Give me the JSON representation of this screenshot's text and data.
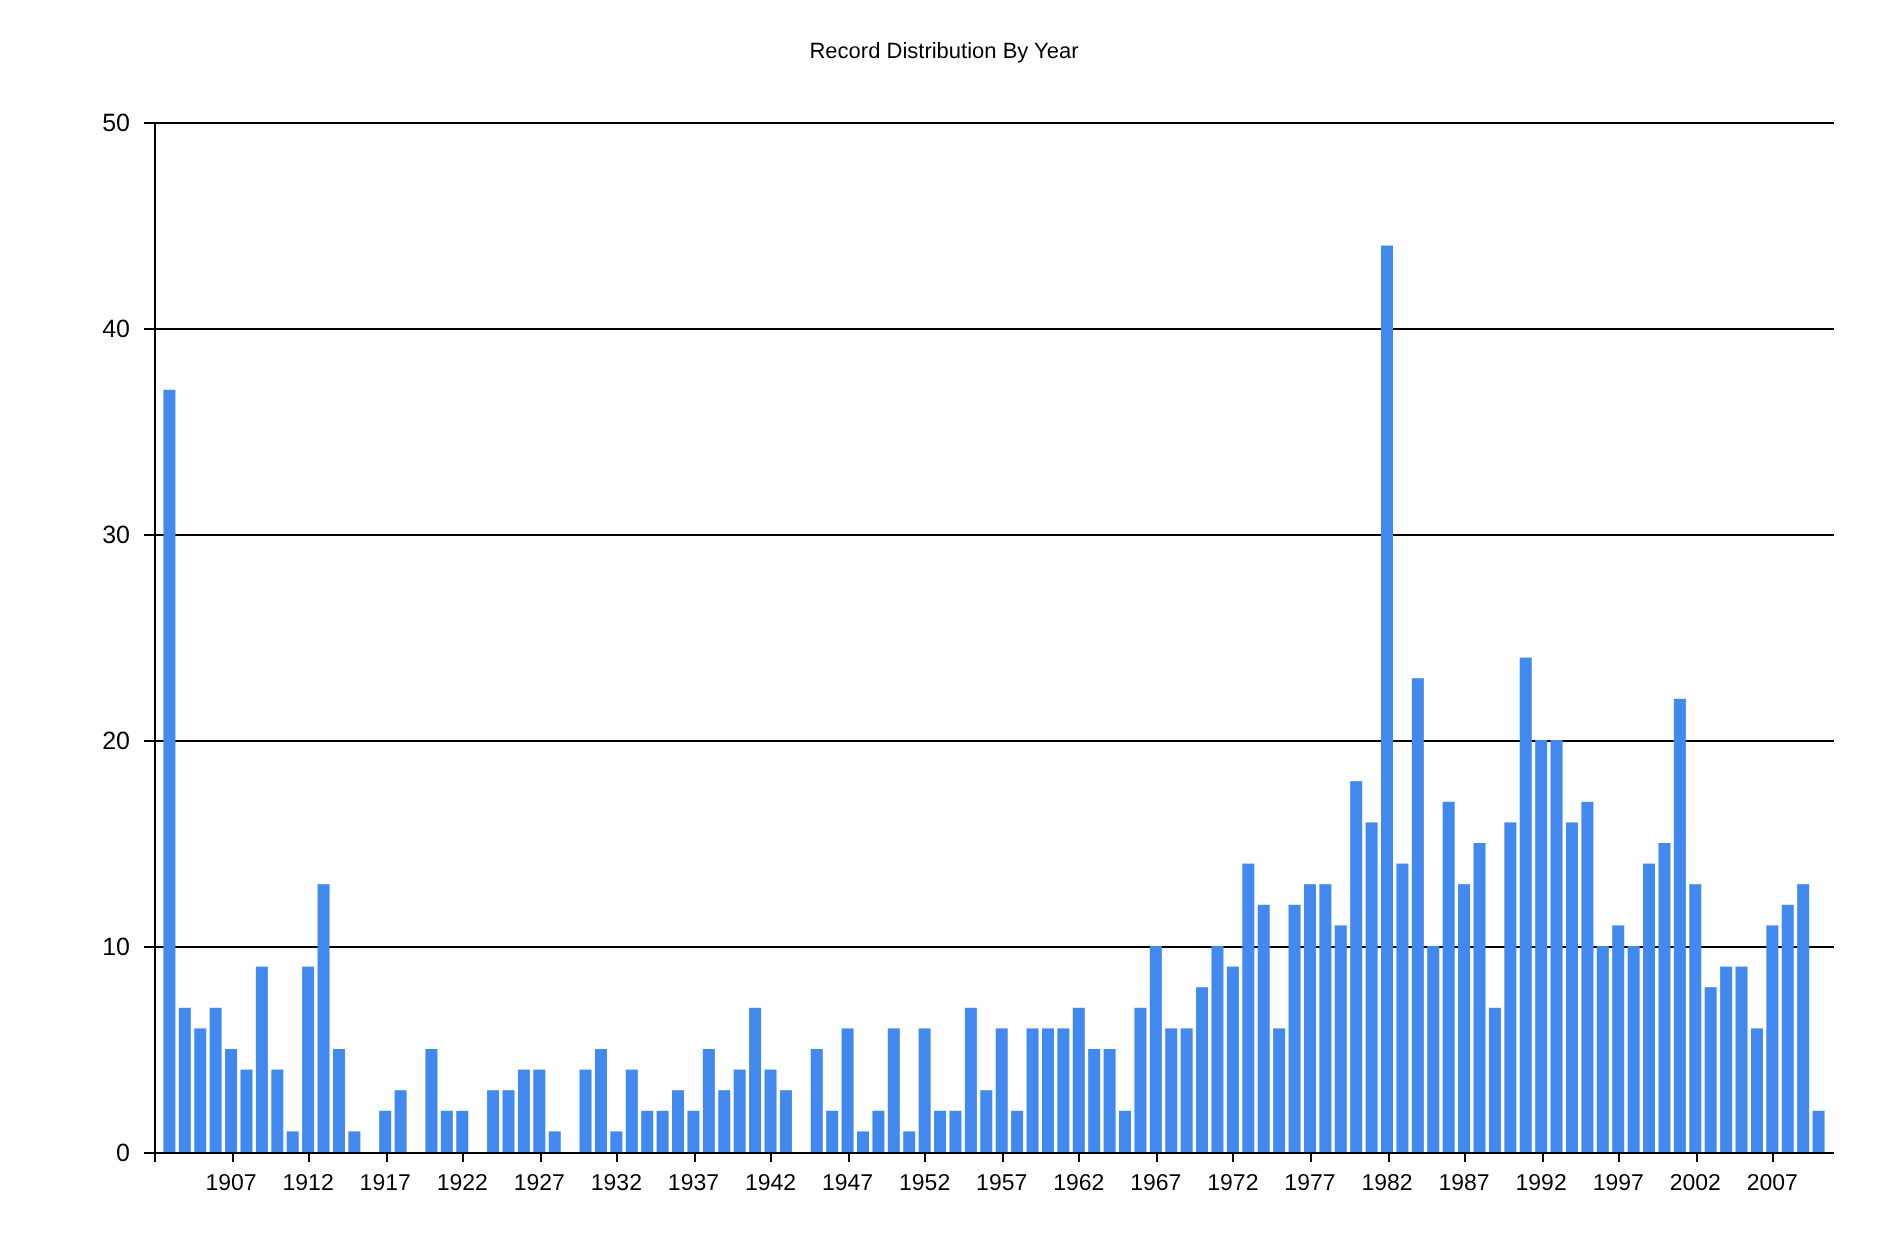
{
  "chart_data": {
    "type": "bar",
    "title": "Record Distribution By Year",
    "x": [
      1903,
      1904,
      1905,
      1906,
      1907,
      1908,
      1909,
      1910,
      1911,
      1912,
      1913,
      1914,
      1915,
      1916,
      1917,
      1918,
      1919,
      1920,
      1921,
      1922,
      1923,
      1924,
      1925,
      1926,
      1927,
      1928,
      1929,
      1930,
      1931,
      1932,
      1933,
      1934,
      1935,
      1936,
      1937,
      1938,
      1939,
      1940,
      1941,
      1942,
      1943,
      1944,
      1945,
      1946,
      1947,
      1948,
      1949,
      1950,
      1951,
      1952,
      1953,
      1954,
      1955,
      1956,
      1957,
      1958,
      1959,
      1960,
      1961,
      1962,
      1963,
      1964,
      1965,
      1966,
      1967,
      1968,
      1969,
      1970,
      1971,
      1972,
      1973,
      1974,
      1975,
      1976,
      1977,
      1978,
      1979,
      1980,
      1981,
      1982,
      1983,
      1984,
      1985,
      1986,
      1987,
      1988,
      1989,
      1990,
      1991,
      1992,
      1993,
      1994,
      1995,
      1996,
      1997,
      1998,
      1999,
      2000,
      2001,
      2002,
      2003,
      2004,
      2005,
      2006,
      2007,
      2008,
      2009,
      2010
    ],
    "series": [
      {
        "color": "#4189ee",
        "values": [
          37,
          7,
          6,
          7,
          5,
          4,
          9,
          4,
          1,
          9,
          13,
          5,
          1,
          0,
          2,
          3,
          0,
          5,
          2,
          2,
          0,
          3,
          3,
          4,
          4,
          1,
          0,
          4,
          5,
          1,
          4,
          2,
          2,
          3,
          2,
          5,
          3,
          4,
          7,
          4,
          3,
          0,
          5,
          2,
          6,
          1,
          2,
          6,
          1,
          6,
          2,
          2,
          7,
          3,
          6,
          2,
          6,
          6,
          6,
          7,
          5,
          5,
          2,
          7,
          10,
          6,
          6,
          8,
          10,
          9,
          14,
          12,
          6,
          12,
          13,
          13,
          11,
          18,
          16,
          44,
          14,
          23,
          10,
          17,
          13,
          15,
          7,
          16,
          24,
          20,
          20,
          16,
          17,
          10,
          11,
          10,
          14,
          15,
          22,
          13,
          8,
          9,
          9,
          6,
          11,
          12,
          13,
          2
        ]
      }
    ],
    "xlim": [
      1902,
      2011
    ],
    "ylim": [
      0,
      50
    ],
    "xticks": [
      1907,
      1912,
      1917,
      1922,
      1927,
      1932,
      1937,
      1942,
      1947,
      1952,
      1957,
      1962,
      1967,
      1972,
      1977,
      1982,
      1987,
      1992,
      1997,
      2002,
      2007
    ],
    "yticks": [
      0,
      10,
      20,
      30,
      40,
      50
    ],
    "grid": true
  }
}
